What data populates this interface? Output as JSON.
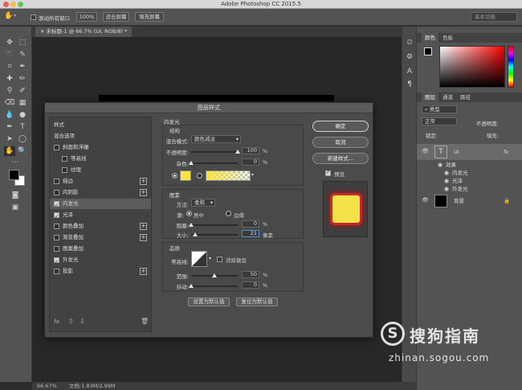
{
  "window": {
    "title": "Adobe Photoshop CC 2015.5"
  },
  "options_bar": {
    "scroll_all_label": "滚动所有窗口",
    "zoom_100": "100%",
    "fit_screen": "适合屏幕",
    "fill_screen": "填充屏幕",
    "workspace": "基本功能"
  },
  "document": {
    "tab_title": "未标题-1 @ 66.7% (UI, RGB/8) *",
    "zoom": "66.67%",
    "doc_info": "文档:1.83M/2.99M"
  },
  "panels": {
    "color_tabs": [
      "颜色",
      "色板"
    ],
    "layer_tabs": [
      "图层",
      "通道",
      "路径"
    ],
    "layer_kind": "类型",
    "blend_mode": "正常",
    "opacity_label": "不透明度:",
    "lock_label": "锁定:",
    "fill_label": "填充:",
    "layers": [
      {
        "name": "UI",
        "effects_label": "效果",
        "effects": [
          "内发光",
          "光泽",
          "外发光"
        ]
      },
      {
        "name": "背景"
      }
    ]
  },
  "dialog": {
    "title": "图层样式",
    "styles": [
      {
        "label": "样式",
        "checkbox": false,
        "checked": false,
        "plus": false
      },
      {
        "label": "混合选项",
        "checkbox": false,
        "checked": false,
        "plus": false
      },
      {
        "label": "斜面和浮雕",
        "checkbox": true,
        "checked": false,
        "plus": false
      },
      {
        "label": "等高线",
        "checkbox": true,
        "checked": false,
        "plus": false,
        "indent": true
      },
      {
        "label": "纹理",
        "checkbox": true,
        "checked": false,
        "plus": false,
        "indent": true
      },
      {
        "label": "描边",
        "checkbox": true,
        "checked": false,
        "plus": true
      },
      {
        "label": "内阴影",
        "checkbox": true,
        "checked": false,
        "plus": true
      },
      {
        "label": "内发光",
        "checkbox": true,
        "checked": true,
        "plus": false,
        "selected": true
      },
      {
        "label": "光泽",
        "checkbox": true,
        "checked": true,
        "plus": false
      },
      {
        "label": "颜色叠加",
        "checkbox": true,
        "checked": false,
        "plus": true
      },
      {
        "label": "渐变叠加",
        "checkbox": true,
        "checked": false,
        "plus": true
      },
      {
        "label": "图案叠加",
        "checkbox": true,
        "checked": false,
        "plus": false
      },
      {
        "label": "外发光",
        "checkbox": true,
        "checked": true,
        "plus": false
      },
      {
        "label": "投影",
        "checkbox": true,
        "checked": false,
        "plus": true
      }
    ],
    "inner_glow": {
      "section_title": "内发光",
      "structure_title": "结构",
      "blend_mode_label": "混合模式:",
      "blend_mode_value": "颜色减淡",
      "opacity_label": "不透明度:",
      "opacity_value": "100",
      "opacity_fraction": 1.0,
      "noise_label": "杂色:",
      "noise_value": "0",
      "noise_fraction": 0.0,
      "percent": "%",
      "glow_color": "#f7e343",
      "elements_title": "图素",
      "method_label": "方法:",
      "method_value": "柔和",
      "source_label": "源:",
      "source_center": "居中",
      "source_edge": "边缘",
      "choke_label": "阻塞:",
      "choke_value": "0",
      "choke_fraction": 0.0,
      "size_label": "大小:",
      "size_value": "21",
      "size_fraction": 0.084,
      "px_unit": "像素",
      "quality_title": "品质",
      "contour_label": "等高线:",
      "anti_alias_label": "消除锯齿",
      "range_label": "范围:",
      "range_value": "50",
      "range_fraction": 0.5,
      "jitter_label": "抖动:",
      "jitter_value": "0",
      "jitter_fraction": 0.0,
      "set_default": "设置为默认值",
      "reset_default": "复位为默认值"
    },
    "buttons": {
      "ok": "确定",
      "cancel": "取消",
      "new_style": "新建样式...",
      "preview": "预览"
    },
    "footer_fx": "fx."
  },
  "watermark": {
    "title": "搜狗指南",
    "url": "zhinan.sogou.com",
    "logo_glyph": "S"
  }
}
